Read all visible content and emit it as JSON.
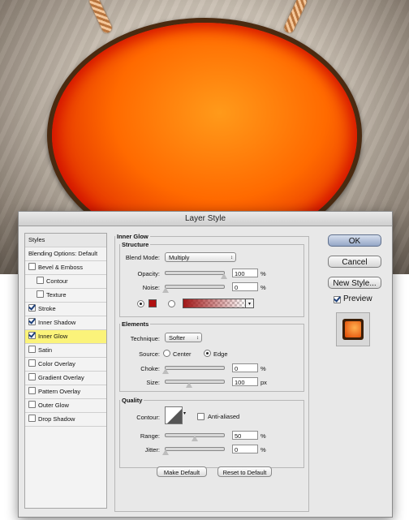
{
  "dialog": {
    "title": "Layer Style"
  },
  "styles_panel": {
    "header": "Styles",
    "items": [
      {
        "label": "Blending Options: Default",
        "checkbox": false,
        "checked": false,
        "indent": false,
        "active": false
      },
      {
        "label": "Bevel & Emboss",
        "checkbox": true,
        "checked": false,
        "indent": false,
        "active": false
      },
      {
        "label": "Contour",
        "checkbox": true,
        "checked": false,
        "indent": true,
        "active": false
      },
      {
        "label": "Texture",
        "checkbox": true,
        "checked": false,
        "indent": true,
        "active": false
      },
      {
        "label": "Stroke",
        "checkbox": true,
        "checked": true,
        "indent": false,
        "active": false
      },
      {
        "label": "Inner Shadow",
        "checkbox": true,
        "checked": true,
        "indent": false,
        "active": false
      },
      {
        "label": "Inner Glow",
        "checkbox": true,
        "checked": true,
        "indent": false,
        "active": true
      },
      {
        "label": "Satin",
        "checkbox": true,
        "checked": false,
        "indent": false,
        "active": false
      },
      {
        "label": "Color Overlay",
        "checkbox": true,
        "checked": false,
        "indent": false,
        "active": false
      },
      {
        "label": "Gradient Overlay",
        "checkbox": true,
        "checked": false,
        "indent": false,
        "active": false
      },
      {
        "label": "Pattern Overlay",
        "checkbox": true,
        "checked": false,
        "indent": false,
        "active": false
      },
      {
        "label": "Outer Glow",
        "checkbox": true,
        "checked": false,
        "indent": false,
        "active": false
      },
      {
        "label": "Drop Shadow",
        "checkbox": true,
        "checked": false,
        "indent": false,
        "active": false
      }
    ]
  },
  "inner_glow": {
    "title": "Inner Glow",
    "structure": {
      "title": "Structure",
      "blend_mode_label": "Blend Mode:",
      "blend_mode_value": "Multiply",
      "opacity_label": "Opacity:",
      "opacity_value": "100",
      "opacity_level": 1.0,
      "noise_label": "Noise:",
      "noise_value": "0",
      "noise_level": 0.0,
      "percent": "%",
      "color_swatch": "#b01010",
      "gradient_from": "#a01818",
      "selected_source": "color"
    },
    "elements": {
      "title": "Elements",
      "technique_label": "Technique:",
      "technique_value": "Softer",
      "source_label": "Source:",
      "source_center": "Center",
      "source_edge": "Edge",
      "source_selected": "Edge",
      "choke_label": "Choke:",
      "choke_value": "0",
      "choke_level": 0.0,
      "size_label": "Size:",
      "size_value": "100",
      "size_level": 0.4,
      "percent": "%",
      "px": "px"
    },
    "quality": {
      "title": "Quality",
      "contour_label": "Contour:",
      "anti_aliased_label": "Anti-aliased",
      "anti_aliased": false,
      "range_label": "Range:",
      "range_value": "50",
      "range_level": 0.5,
      "jitter_label": "Jitter:",
      "jitter_value": "0",
      "jitter_level": 0.0,
      "percent": "%"
    },
    "make_default": "Make Default",
    "reset_default": "Reset to Default"
  },
  "actions": {
    "ok": "OK",
    "cancel": "Cancel",
    "new_style": "New Style...",
    "preview_label": "Preview",
    "preview_checked": true
  },
  "colors": {
    "accent_active_row": "#fbf37a",
    "default_button": "#95a7c6",
    "glow_orange": "#ff6a00"
  }
}
